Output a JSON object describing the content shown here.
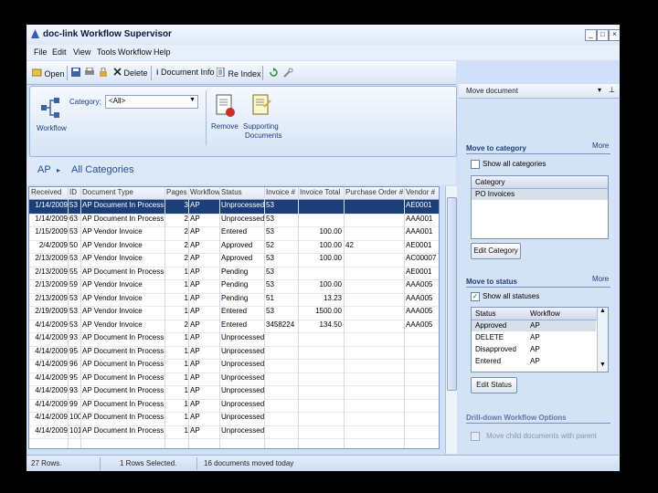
{
  "window": {
    "title": "doc-link Workflow Supervisor"
  },
  "menu": [
    "File",
    "Edit",
    "View",
    "Tools",
    "Workflow",
    "Help"
  ],
  "toolbar": {
    "open": "Open",
    "delete": "Delete",
    "doc_info": "Document Info",
    "re_index": "Re Index"
  },
  "ribbon": {
    "workflow_label": "Workflow",
    "category_label": "Category:",
    "category_value": "<All>",
    "remove_label": "Remove",
    "supporting_label_1": "Supporting",
    "supporting_label_2": "Documents"
  },
  "breadcrumb": {
    "root": "AP",
    "sep": "▸",
    "current": "All Categories"
  },
  "grid": {
    "columns": [
      "Received",
      "ID",
      "Document Type",
      "Pages",
      "Workflow",
      "Status",
      "Invoice #",
      "Invoice Total",
      "Purchase Order #",
      "Vendor #"
    ],
    "rows": [
      [
        "1/14/2009",
        "53",
        "AP Document In Process",
        "3",
        "AP",
        "Unprocessed",
        "53",
        "",
        "",
        "AE0001"
      ],
      [
        "1/14/2009",
        "63",
        "AP Document In Process",
        "2",
        "AP",
        "Unprocessed",
        "53",
        "",
        "",
        "AAA001"
      ],
      [
        "1/15/2009",
        "53",
        "AP Vendor Invoice",
        "2",
        "AP",
        "Entered",
        "53",
        "100.00",
        "",
        "AAA001"
      ],
      [
        "2/4/2009",
        "50",
        "AP Vendor Invoice",
        "2",
        "AP",
        "Approved",
        "52",
        "100.00",
        "42",
        "AE0001"
      ],
      [
        "2/13/2009",
        "53",
        "AP Vendor Invoice",
        "2",
        "AP",
        "Approved",
        "53",
        "100.00",
        "",
        "AC00007"
      ],
      [
        "2/13/2009",
        "55",
        "AP Document In Process",
        "1",
        "AP",
        "Pending",
        "53",
        "",
        "",
        "AE0001"
      ],
      [
        "2/13/2009",
        "59",
        "AP Vendor Invoice",
        "1",
        "AP",
        "Pending",
        "53",
        "100.00",
        "",
        "AAA005"
      ],
      [
        "2/13/2009",
        "53",
        "AP Vendor Invoice",
        "1",
        "AP",
        "Pending",
        "51",
        "13.23",
        "",
        "AAA005"
      ],
      [
        "2/19/2009",
        "53",
        "AP Vendor Invoice",
        "1",
        "AP",
        "Entered",
        "53",
        "1500.00",
        "",
        "AAA005"
      ],
      [
        "4/14/2009",
        "53",
        "AP Vendor Invoice",
        "2",
        "AP",
        "Entered",
        "3458224",
        "134.50",
        "",
        "AAA005"
      ],
      [
        "4/14/2009",
        "93",
        "AP Document In Process",
        "1",
        "AP",
        "Unprocessed",
        "",
        "",
        "",
        ""
      ],
      [
        "4/14/2009",
        "95",
        "AP Document In Process",
        "1",
        "AP",
        "Unprocessed",
        "",
        "",
        "",
        ""
      ],
      [
        "4/14/2009",
        "96",
        "AP Document In Process",
        "1",
        "AP",
        "Unprocessed",
        "",
        "",
        "",
        ""
      ],
      [
        "4/14/2009",
        "95",
        "AP Document In Process",
        "1",
        "AP",
        "Unprocessed",
        "",
        "",
        "",
        ""
      ],
      [
        "4/14/2009",
        "93",
        "AP Document In Process",
        "1",
        "AP",
        "Unprocessed",
        "",
        "",
        "",
        ""
      ],
      [
        "4/14/2009",
        "99",
        "AP Document In Process",
        "1",
        "AP",
        "Unprocessed",
        "",
        "",
        "",
        ""
      ],
      [
        "4/14/2009",
        "100",
        "AP Document In Process",
        "1",
        "AP",
        "Unprocessed",
        "",
        "",
        "",
        ""
      ],
      [
        "4/14/2009",
        "101",
        "AP Document In Process",
        "1",
        "AP",
        "Unprocessed",
        "",
        "",
        "",
        ""
      ]
    ]
  },
  "status": {
    "rows": "27 Rows.",
    "selected": "1 Rows Selected.",
    "moved": "16 documents moved today"
  },
  "panel": {
    "title": "Move document",
    "category_section": "Move to category",
    "more": "More",
    "show_all_categories": "Show all categories",
    "category_header": "Category",
    "categories": [
      "PO Invoices"
    ],
    "edit_category": "Edit Category",
    "status_section": "Move to status",
    "show_all_statuses": "Show all statuses",
    "status_headers": [
      "Status",
      "Workflow"
    ],
    "statuses": [
      [
        "Approved",
        "AP"
      ],
      [
        "DELETE",
        "AP"
      ],
      [
        "Disapproved",
        "AP"
      ],
      [
        "Entered",
        "AP"
      ]
    ],
    "edit_status": "Edit Status",
    "drilldown_section": "Drill-down Workflow Options",
    "move_child": "Move child documents with parent"
  }
}
